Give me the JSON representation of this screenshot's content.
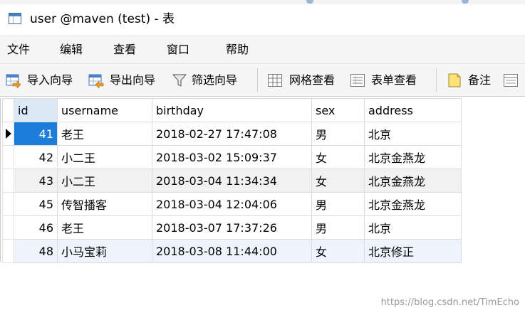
{
  "window": {
    "title": "user @maven (test) - 表"
  },
  "menu": [
    "文件",
    "编辑",
    "查看",
    "窗口",
    "帮助"
  ],
  "toolbar": {
    "import_wizard": "导入向导",
    "export_wizard": "导出向导",
    "filter_wizard": "筛选向导",
    "grid_view": "网格查看",
    "form_view": "表单查看",
    "memo": "备注"
  },
  "table": {
    "columns": [
      "id",
      "username",
      "birthday",
      "sex",
      "address"
    ],
    "rows": [
      [
        "41",
        "老王",
        "2018-02-27 17:47:08",
        "男",
        "北京"
      ],
      [
        "42",
        "小二王",
        "2018-03-02 15:09:37",
        "女",
        "北京金燕龙"
      ],
      [
        "43",
        "小二王",
        "2018-03-04 11:34:34",
        "女",
        "北京金燕龙"
      ],
      [
        "45",
        "传智播客",
        "2018-03-04 12:04:06",
        "男",
        "北京金燕龙"
      ],
      [
        "46",
        "老王",
        "2018-03-07 17:37:26",
        "男",
        "北京"
      ],
      [
        "48",
        "小马宝莉",
        "2018-03-08 11:44:00",
        "女",
        "北京修正"
      ]
    ]
  },
  "watermark": "https://blog.csdn.net/TimEcho",
  "colors": {
    "selection": "#1d7ddb",
    "selected_header": "#dde9f6"
  }
}
